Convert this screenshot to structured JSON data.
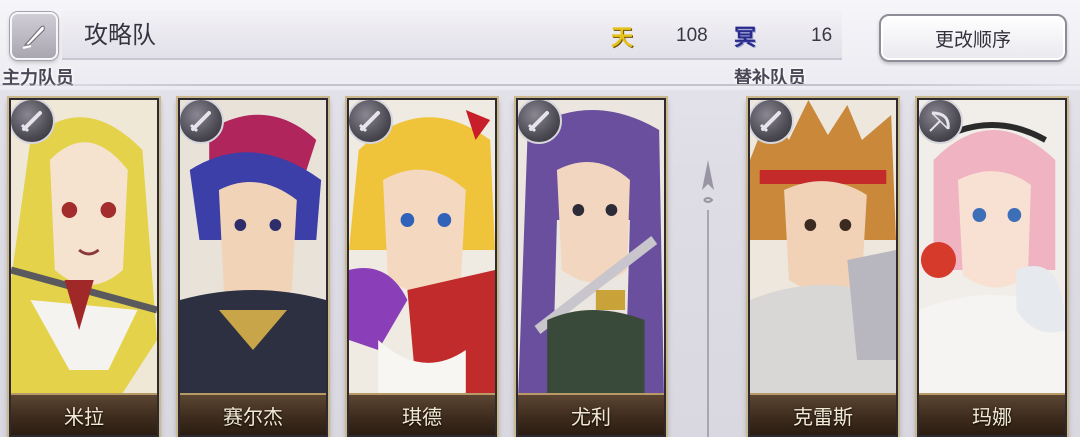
{
  "header": {
    "team_name": "攻略队",
    "sky_icon": "天",
    "sky_value": "108",
    "earth_icon": "冥",
    "earth_value": "16",
    "reorder_label": "更改顺序",
    "edit_icon": "quill-icon"
  },
  "sections": {
    "main_label": "主力队员",
    "sub_label": "替补队员"
  },
  "main_members": [
    {
      "name": "米拉",
      "weapon": "sword-icon"
    },
    {
      "name": "赛尔杰",
      "weapon": "sword-icon"
    },
    {
      "name": "琪德",
      "weapon": "sword-icon"
    },
    {
      "name": "尤利",
      "weapon": "sword-icon"
    }
  ],
  "sub_members": [
    {
      "name": "克雷斯",
      "weapon": "sword-icon"
    },
    {
      "name": "玛娜",
      "weapon": "bow-icon"
    }
  ],
  "colors": {
    "sky_icon": "#e8c21c",
    "earth_icon": "#2a2a8c",
    "name_plate": "#3e2c1e",
    "card_frame": "#cbb88c"
  }
}
